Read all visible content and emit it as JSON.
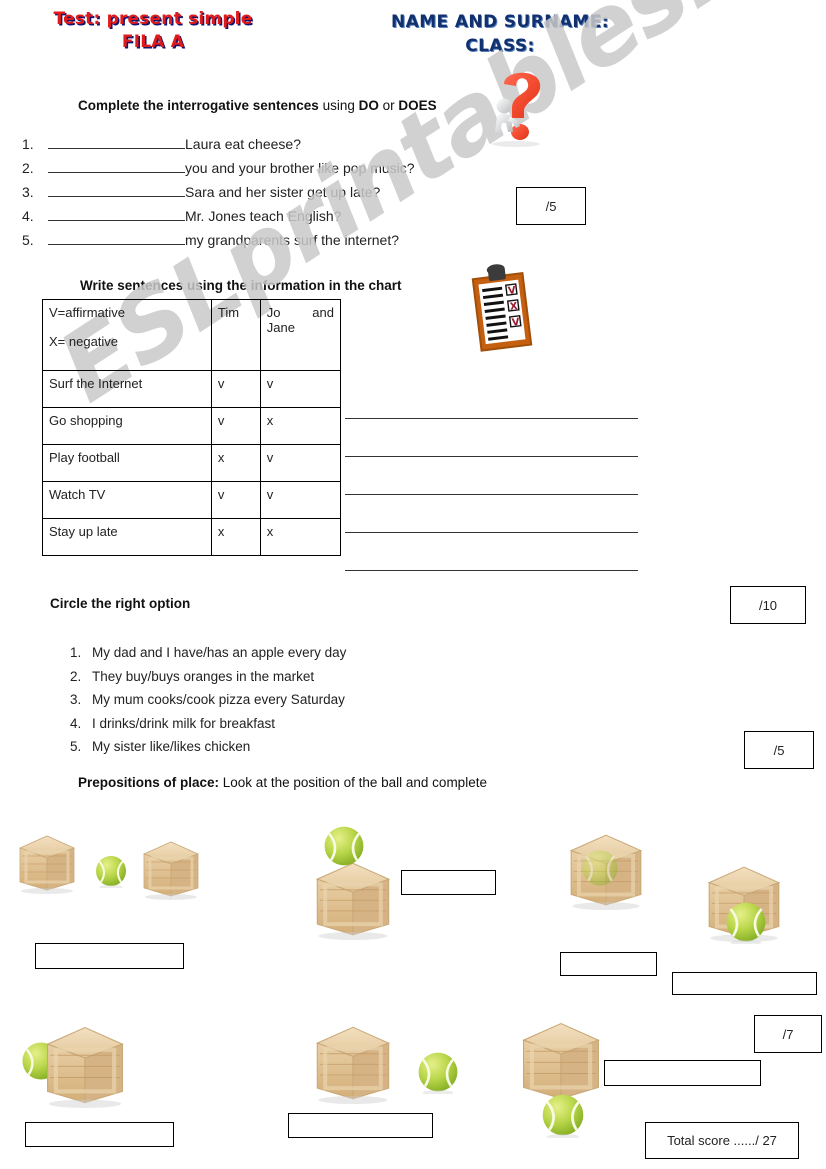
{
  "header": {
    "title_line1": "Test: present simple",
    "title_line2": "FILA A",
    "title_color": "#e01b1b",
    "title_shadow_color": "#14146e",
    "name_label": "NAME AND SURNAME:",
    "class_label": "CLASS:",
    "name_color": "#10306e"
  },
  "watermark": {
    "text": "ESLprintables.com",
    "color": "#c9c9c9"
  },
  "ex1": {
    "instruction_bold": "Complete the interrogative sentences",
    "instruction_rest": " using ",
    "do_word": "DO",
    "or_word": " or ",
    "does_word": "DOES",
    "items": [
      {
        "num": "1.",
        "text": "Laura eat cheese?"
      },
      {
        "num": "2.",
        "text": "you and your brother like pop music?"
      },
      {
        "num": "3.",
        "text": "Sara and her sister get up late?"
      },
      {
        "num": "4.",
        "text": "Mr. Jones teach English?"
      },
      {
        "num": "5.",
        "text": "my grandparents surf the internet?"
      }
    ],
    "score": "/5"
  },
  "ex2": {
    "instruction": "Write sentences using the information in the chart",
    "score": "/10",
    "chart_data": {
      "type": "table",
      "title": "Write sentences using the information in the chart",
      "legend": [
        "V=affirmative",
        "X= negative"
      ],
      "columns": [
        "",
        "Tim",
        "Jo   and Jane"
      ],
      "rows": [
        {
          "activity": "Surf the Internet",
          "tim": "v",
          "jo_and_jane": "v"
        },
        {
          "activity": "Go shopping",
          "tim": "v",
          "jo_and_jane": "x"
        },
        {
          "activity": "Play football",
          "tim": "x",
          "jo_and_jane": "v"
        },
        {
          "activity": "Watch TV",
          "tim": "v",
          "jo_and_jane": "v"
        },
        {
          "activity": "Stay up late",
          "tim": "x",
          "jo_and_jane": "x"
        }
      ],
      "answer_lines": 5
    }
  },
  "ex3": {
    "instruction": "Circle the right option",
    "score": "/5",
    "items": [
      {
        "num": "1.",
        "text": "My dad and I have/has an apple every day"
      },
      {
        "num": "2.",
        "text": "They buy/buys oranges in the market"
      },
      {
        "num": "3.",
        "text": "My mum cooks/cook pizza every Saturday"
      },
      {
        "num": "4.",
        "text": "I drinks/drink milk for breakfast"
      },
      {
        "num": "5.",
        "text": "My sister like/likes chicken"
      }
    ]
  },
  "ex4": {
    "instruction_bold": "Prepositions of place:",
    "instruction_rest": " Look at the position of the ball and complete",
    "score": "/7",
    "pictures": [
      {
        "id": "pic-between",
        "answer": ""
      },
      {
        "id": "pic-on",
        "answer": ""
      },
      {
        "id": "pic-in",
        "answer": ""
      },
      {
        "id": "pic-in-front",
        "answer": ""
      },
      {
        "id": "pic-behind",
        "answer": ""
      },
      {
        "id": "pic-next-to",
        "answer": ""
      },
      {
        "id": "pic-under",
        "answer": ""
      }
    ]
  },
  "total": {
    "label": "Total score ....../   27"
  },
  "icons": {
    "question_mark": "question-mark-icon",
    "clipboard": "clipboard-checklist-icon",
    "crate": "wooden-crate-icon",
    "ball": "tennis-ball-icon"
  }
}
